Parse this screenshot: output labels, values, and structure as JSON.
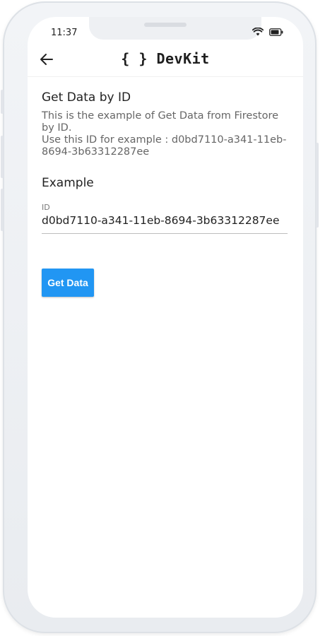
{
  "status_bar": {
    "time": "11:37",
    "icons": [
      "wifi-icon",
      "battery-icon"
    ]
  },
  "app_bar": {
    "back_icon": "arrow-left-icon",
    "logo_text": "{ } DevKit"
  },
  "page": {
    "title": "Get Data by ID",
    "description_line1": "This is the example of Get Data from Firestore by ID.",
    "description_line2": "Use this ID for example : d0bd7110-a341-11eb-8694-3b63312287ee",
    "section_title": "Example"
  },
  "form": {
    "id_label": "ID",
    "id_value": "d0bd7110-a341-11eb-8694-3b63312287ee"
  },
  "actions": {
    "get_data_label": "Get Data"
  },
  "colors": {
    "accent": "#2196f3",
    "text_primary": "#222222",
    "text_secondary": "#666666"
  }
}
